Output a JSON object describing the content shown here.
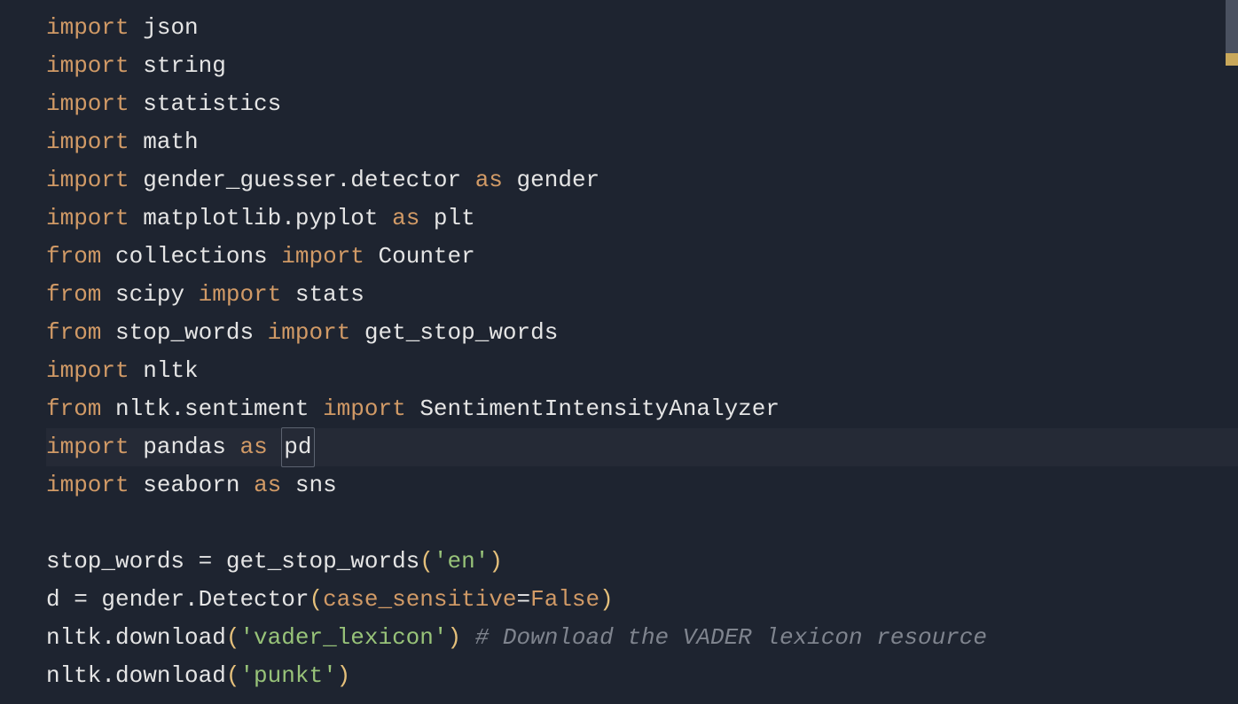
{
  "code": {
    "lines": [
      {
        "tokens": [
          {
            "t": "import",
            "c": "kw"
          },
          {
            "t": " ",
            "c": "pl"
          },
          {
            "t": "json",
            "c": "id"
          }
        ]
      },
      {
        "tokens": [
          {
            "t": "import",
            "c": "kw"
          },
          {
            "t": " ",
            "c": "pl"
          },
          {
            "t": "string",
            "c": "id"
          }
        ]
      },
      {
        "tokens": [
          {
            "t": "import",
            "c": "kw"
          },
          {
            "t": " ",
            "c": "pl"
          },
          {
            "t": "statistics",
            "c": "id"
          }
        ]
      },
      {
        "tokens": [
          {
            "t": "import",
            "c": "kw"
          },
          {
            "t": " ",
            "c": "pl"
          },
          {
            "t": "math",
            "c": "id"
          }
        ]
      },
      {
        "tokens": [
          {
            "t": "import",
            "c": "kw"
          },
          {
            "t": " ",
            "c": "pl"
          },
          {
            "t": "gender_guesser.detector",
            "c": "id"
          },
          {
            "t": " ",
            "c": "pl"
          },
          {
            "t": "as",
            "c": "kw"
          },
          {
            "t": " ",
            "c": "pl"
          },
          {
            "t": "gender",
            "c": "id"
          }
        ]
      },
      {
        "tokens": [
          {
            "t": "import",
            "c": "kw"
          },
          {
            "t": " ",
            "c": "pl"
          },
          {
            "t": "matplotlib.pyplot",
            "c": "id"
          },
          {
            "t": " ",
            "c": "pl"
          },
          {
            "t": "as",
            "c": "kw"
          },
          {
            "t": " ",
            "c": "pl"
          },
          {
            "t": "plt",
            "c": "id"
          }
        ]
      },
      {
        "tokens": [
          {
            "t": "from",
            "c": "kw"
          },
          {
            "t": " ",
            "c": "pl"
          },
          {
            "t": "collections",
            "c": "id"
          },
          {
            "t": " ",
            "c": "pl"
          },
          {
            "t": "import",
            "c": "kw"
          },
          {
            "t": " ",
            "c": "pl"
          },
          {
            "t": "Counter",
            "c": "id"
          }
        ]
      },
      {
        "tokens": [
          {
            "t": "from",
            "c": "kw"
          },
          {
            "t": " ",
            "c": "pl"
          },
          {
            "t": "scipy",
            "c": "id"
          },
          {
            "t": " ",
            "c": "pl"
          },
          {
            "t": "import",
            "c": "kw"
          },
          {
            "t": " ",
            "c": "pl"
          },
          {
            "t": "stats",
            "c": "id"
          }
        ]
      },
      {
        "tokens": [
          {
            "t": "from",
            "c": "kw"
          },
          {
            "t": " ",
            "c": "pl"
          },
          {
            "t": "stop_words",
            "c": "id"
          },
          {
            "t": " ",
            "c": "pl"
          },
          {
            "t": "import",
            "c": "kw"
          },
          {
            "t": " ",
            "c": "pl"
          },
          {
            "t": "get_stop_words",
            "c": "id"
          }
        ]
      },
      {
        "tokens": [
          {
            "t": "import",
            "c": "kw"
          },
          {
            "t": " ",
            "c": "pl"
          },
          {
            "t": "nltk",
            "c": "id"
          }
        ]
      },
      {
        "tokens": [
          {
            "t": "from",
            "c": "kw"
          },
          {
            "t": " ",
            "c": "pl"
          },
          {
            "t": "nltk.sentiment",
            "c": "id"
          },
          {
            "t": " ",
            "c": "pl"
          },
          {
            "t": "import",
            "c": "kw"
          },
          {
            "t": " ",
            "c": "pl"
          },
          {
            "t": "SentimentIntensityAnalyzer",
            "c": "id"
          }
        ]
      },
      {
        "highlighted": true,
        "tokens": [
          {
            "t": "import",
            "c": "kw"
          },
          {
            "t": " ",
            "c": "pl"
          },
          {
            "t": "pandas",
            "c": "id"
          },
          {
            "t": " ",
            "c": "pl"
          },
          {
            "t": "as",
            "c": "kw"
          },
          {
            "t": " ",
            "c": "pl"
          },
          {
            "t": "pd",
            "c": "id",
            "boxed": true
          }
        ]
      },
      {
        "tokens": [
          {
            "t": "import",
            "c": "kw"
          },
          {
            "t": " ",
            "c": "pl"
          },
          {
            "t": "seaborn",
            "c": "id"
          },
          {
            "t": " ",
            "c": "pl"
          },
          {
            "t": "as",
            "c": "kw"
          },
          {
            "t": " ",
            "c": "pl"
          },
          {
            "t": "sns",
            "c": "id"
          }
        ]
      },
      {
        "tokens": [
          {
            "t": "",
            "c": "pl"
          }
        ]
      },
      {
        "tokens": [
          {
            "t": "stop_words ",
            "c": "id"
          },
          {
            "t": "=",
            "c": "eq"
          },
          {
            "t": " get_stop_words",
            "c": "id"
          },
          {
            "t": "(",
            "c": "paren-y"
          },
          {
            "t": "'en'",
            "c": "str"
          },
          {
            "t": ")",
            "c": "paren-y"
          }
        ]
      },
      {
        "tokens": [
          {
            "t": "d ",
            "c": "id"
          },
          {
            "t": "=",
            "c": "eq"
          },
          {
            "t": " gender.Detector",
            "c": "id"
          },
          {
            "t": "(",
            "c": "paren-y"
          },
          {
            "t": "case_sensitive",
            "c": "arg"
          },
          {
            "t": "=",
            "c": "eq"
          },
          {
            "t": "False",
            "c": "false"
          },
          {
            "t": ")",
            "c": "paren-y"
          }
        ]
      },
      {
        "tokens": [
          {
            "t": "nltk.download",
            "c": "id"
          },
          {
            "t": "(",
            "c": "paren-y"
          },
          {
            "t": "'vader_lexicon'",
            "c": "str"
          },
          {
            "t": ")",
            "c": "paren-y"
          },
          {
            "t": " ",
            "c": "pl"
          },
          {
            "t": "# Download the VADER lexicon resource",
            "c": "com"
          }
        ]
      },
      {
        "tokens": [
          {
            "t": "nltk.download",
            "c": "id"
          },
          {
            "t": "(",
            "c": "paren-y"
          },
          {
            "t": "'punkt'",
            "c": "str"
          },
          {
            "t": ")",
            "c": "paren-y"
          }
        ]
      }
    ]
  }
}
